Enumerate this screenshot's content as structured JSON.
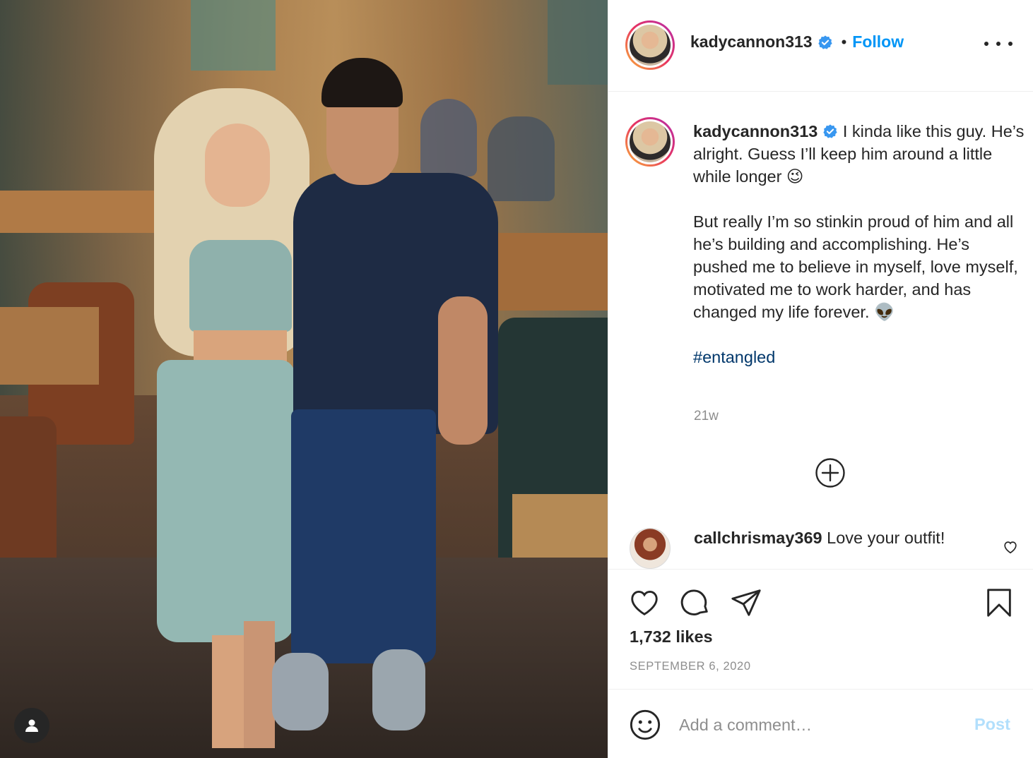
{
  "post": {
    "author": "kadycannon313",
    "verified": true,
    "follow_label": "Follow",
    "separator": "•"
  },
  "caption": {
    "username": "kadycannon313",
    "line1": " I kinda like this guy. He’s alright. Guess I’ll keep him around a little while longer 😉",
    "line2": "But really I’m so stinkin proud of him and all he’s building and accomplishing. He’s pushed me to believe in myself, love myself, motivated me to work harder, and has changed my life forever. 👽",
    "hashtag": "#entangled",
    "time": "21w"
  },
  "comments": [
    {
      "username": "callchrismay369",
      "text": " Love your outfit!"
    }
  ],
  "stats": {
    "likes": "1,732 likes",
    "date": "SEPTEMBER 6, 2020"
  },
  "composer": {
    "placeholder": "Add a comment…",
    "post_label": "Post"
  },
  "icons": {
    "verified": "verified-badge-icon",
    "more": "more-options-icon",
    "load_more": "plus-circle-icon",
    "like": "heart-icon",
    "comment": "comment-bubble-icon",
    "share": "paper-plane-icon",
    "save": "bookmark-icon",
    "emoji": "smiley-icon",
    "tag": "user-tag-icon"
  },
  "colors": {
    "accent": "#0095f6",
    "hashtag": "#00376b",
    "secondary_text": "#8e8e8e",
    "post_disabled": "#b2dffc"
  }
}
